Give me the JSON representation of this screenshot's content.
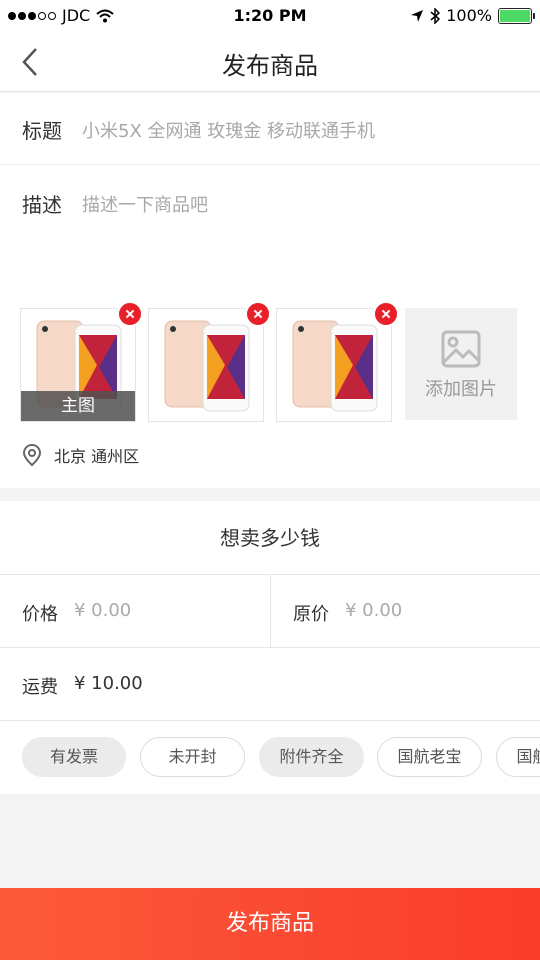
{
  "status_bar": {
    "carrier": "JDC",
    "time": "1:20 PM",
    "battery": "100%",
    "battery_level": 1.0
  },
  "nav": {
    "title": "发布商品",
    "back_icon": "chevron-left-icon"
  },
  "form": {
    "title_label": "标题",
    "title_placeholder": "小米5X 全网通  玫瑰金 移动联通手机",
    "desc_label": "描述",
    "desc_placeholder": "描述一下商品吧",
    "photos": [
      {
        "image": "iphone-8-gold",
        "tag": "主图"
      },
      {
        "image": "iphone-8-gold"
      },
      {
        "image": "iphone-8-gold"
      }
    ],
    "add_photo_label": "添加图片",
    "location": "北京 通州区"
  },
  "price": {
    "heading": "想卖多少钱",
    "price_label": "价格",
    "price_value": "¥ 0.00",
    "original_label": "原价",
    "original_value": "¥ 0.00",
    "freight_label": "运费",
    "freight_value": "¥ 10.00",
    "tags": [
      {
        "label": "有发票",
        "selected": true
      },
      {
        "label": "未开封",
        "selected": false
      },
      {
        "label": "附件齐全",
        "selected": true
      },
      {
        "label": "国航老宝",
        "selected": false
      },
      {
        "label": "国航老宝",
        "selected": false
      }
    ]
  },
  "submit_label": "发布商品",
  "colors": {
    "accent": "#fa3c2a",
    "delete": "#e8202a",
    "battery": "#4cd964"
  }
}
